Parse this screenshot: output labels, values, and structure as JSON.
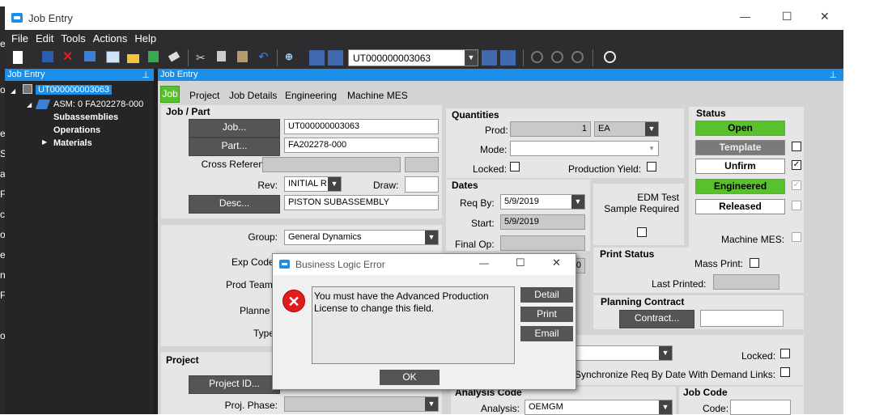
{
  "window": {
    "title": "Job Entry",
    "minimize": "—",
    "maximize": "☐",
    "close": "✕"
  },
  "menu": [
    "File",
    "Edit",
    "Tools",
    "Actions",
    "Help"
  ],
  "toolbar": {
    "job_combo": "UT000000003063"
  },
  "left_edge": [
    "er",
    "o",
    "e",
    "S",
    "al",
    "F",
    "ct",
    "o",
    "er",
    "ni",
    "F",
    "o"
  ],
  "tree": {
    "header": "Job Entry",
    "root": "UT000000003063",
    "asm": "ASM: 0 FA202278-000",
    "children": [
      "Subassemblies",
      "Operations",
      "Materials"
    ]
  },
  "content": {
    "header": "Job Entry",
    "tabs": [
      "Job",
      "Project",
      "Job Details",
      "Engineering",
      "Machine MES"
    ]
  },
  "job_part": {
    "title": "Job / Part",
    "job_btn": "Job...",
    "job_value": "UT000000003063",
    "part_btn": "Part...",
    "part_value": "FA202278-000",
    "cross_ref_label": "Cross Reference:",
    "rev_label": "Rev:",
    "rev_value": "INITIAL R",
    "draw_label": "Draw:",
    "desc_btn": "Desc...",
    "desc_value": "PISTON SUBASSEMBLY"
  },
  "group2": {
    "group_label": "Group:",
    "group_value": "General Dynamics",
    "exp_code_label": "Exp Code",
    "prod_team_label": "Prod Team",
    "planner_label": "Planne",
    "type_label": "Type"
  },
  "project": {
    "title": "Project",
    "project_btn": "Project ID...",
    "phase_label": "Proj. Phase:"
  },
  "quantities": {
    "title": "Quantities",
    "prod_label": "Prod:",
    "prod_value": "1",
    "uom": "EA",
    "mode_label": "Mode:",
    "locked_label": "Locked:",
    "yield_label": "Production Yield:"
  },
  "dates": {
    "title": "Dates",
    "req_by_label": "Req By:",
    "req_by_value": "5/9/2019",
    "start_label": "Start:",
    "start_value": "5/9/2019",
    "final_op_label": "Final Op:",
    "frag_value": "0"
  },
  "edm": {
    "line1": "EDM Test",
    "line2": "Sample Required"
  },
  "status": {
    "title": "Status",
    "open": "Open",
    "template": "Template",
    "unfirm": "Unfirm",
    "engineered": "Engineered",
    "released": "Released",
    "machine_mes": "Machine MES:",
    "colors": {
      "green": "#5ac12e",
      "gray": "#7a7a7a"
    }
  },
  "print_status": {
    "title": "Print Status",
    "mass_print": "Mass Print:",
    "last_printed": "Last Printed:"
  },
  "planning": {
    "title": "Planning Contract",
    "contract_btn": "Contract..."
  },
  "lower_right": {
    "locked_label": "Locked:",
    "sync_label": "Synchronize Req By Date With Demand Links:"
  },
  "analysis": {
    "title": "Analysis Code",
    "label": "Analysis:",
    "value": "OEMGM"
  },
  "job_code": {
    "title": "Job Code",
    "label": "Code:"
  },
  "dialog": {
    "title": "Business Logic Error",
    "message": "You must have the Advanced Production License to change this field.",
    "detail": "Detail",
    "print": "Print",
    "email": "Email",
    "ok": "OK",
    "minimize": "—",
    "maximize": "☐",
    "close": "✕"
  }
}
